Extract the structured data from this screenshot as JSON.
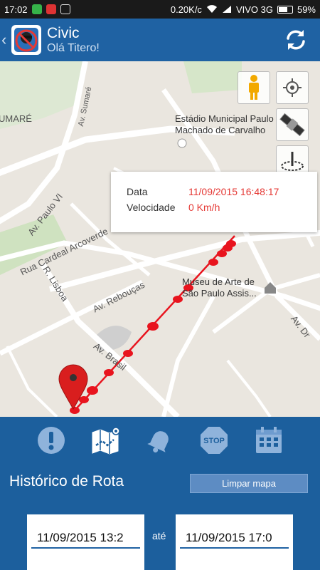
{
  "status_bar": {
    "time": "17:02",
    "network_speed": "0.20K/c",
    "carrier": "VIVO 3G",
    "battery": "59%"
  },
  "header": {
    "title": "Civic",
    "subtitle": "Olá Titero!"
  },
  "map": {
    "street_labels": {
      "sumare_district": "UMARÉ",
      "av_sumare": "Av. Sumaré",
      "av_paulo_vi": "Av. Paulo VI",
      "rua_cardeal": "Rua Cardeal Arcoverde",
      "r_lisboa": "R. Lisboa",
      "av_reboucas": "Av. Rebouças",
      "av_brasil": "Av. Brasil",
      "av_dr_arnaldo_fragment": "Av. Dr"
    },
    "pois": {
      "stadium": [
        "Estádio Municipal Paulo",
        "Machado de Carvalho"
      ],
      "museum": [
        "Museu de Arte de",
        "São Paulo Assis..."
      ]
    },
    "info_window": {
      "date_label": "Data",
      "date_value": "11/09/2015 16:48:17",
      "speed_label": "Velocidade",
      "speed_value": "0 Km/h"
    },
    "route_color": "#e8141e"
  },
  "toolbar": {
    "icons": [
      "alert-icon",
      "map-route-icon",
      "bell-icon",
      "stop-icon",
      "calendar-icon"
    ],
    "stop_text": "STOP"
  },
  "route_history": {
    "title": "Histórico de Rota",
    "clear_button": "Limpar mapa",
    "from_date": "11/09/2015 13:2",
    "separator": "até",
    "to_date": "11/09/2015 17:0"
  }
}
